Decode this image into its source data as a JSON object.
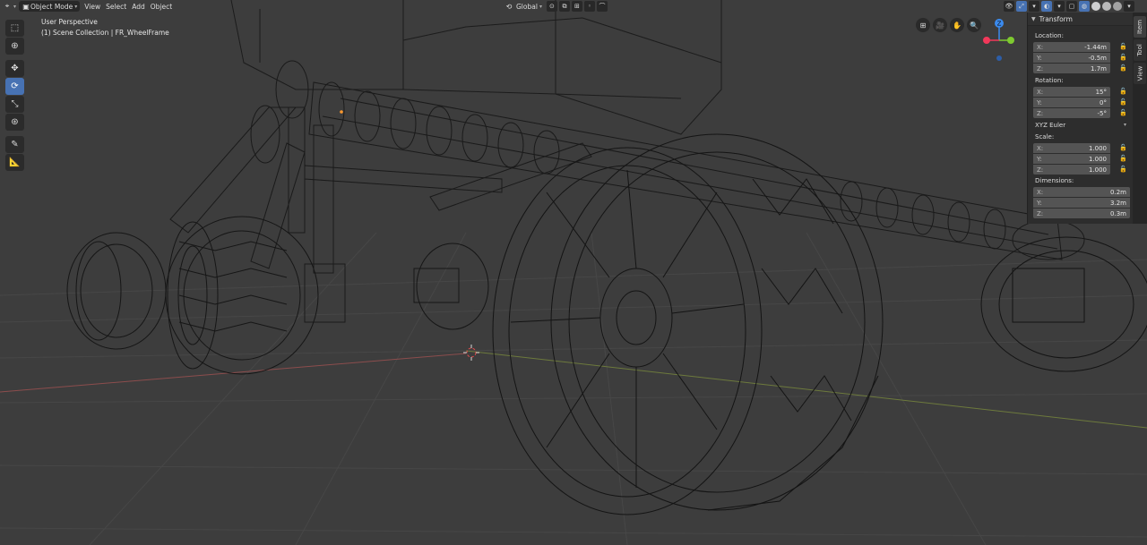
{
  "header": {
    "mode": "Object Mode",
    "menu": [
      "View",
      "Select",
      "Add",
      "Object"
    ],
    "transform_orientation": "Global"
  },
  "overlay": {
    "perspective": "User Perspective",
    "collection": "(1) Scene Collection | FR_WheelFrame"
  },
  "toolbar": {
    "tools": [
      "select-box-icon",
      "cursor-icon",
      "move-icon",
      "rotate-icon",
      "scale-icon",
      "transform-icon",
      "annotate-icon",
      "measure-icon"
    ],
    "active_tool": "rotate-icon"
  },
  "gizmo": {
    "x_color": "#f2385a",
    "y_color": "#7eca30",
    "z_color": "#3b8bef",
    "z_label": "Z"
  },
  "sidebar": {
    "panel_title": "Transform",
    "location": {
      "label": "Location:",
      "x": "-1.44m",
      "y": "-0.5m",
      "z": "1.7m"
    },
    "rotation": {
      "label": "Rotation:",
      "x": "15°",
      "y": "0°",
      "z": "-5°"
    },
    "rotation_mode": "XYZ Euler",
    "scale": {
      "label": "Scale:",
      "x": "1.000",
      "y": "1.000",
      "z": "1.000"
    },
    "dimensions": {
      "label": "Dimensions:",
      "x": "0.2m",
      "y": "3.2m",
      "z": "0.3m"
    },
    "axis_labels": {
      "x": "X:",
      "y": "Y:",
      "z": "Z:"
    },
    "tabs": [
      "Item",
      "Tool",
      "View"
    ]
  },
  "colors": {
    "accent": "#4772b3",
    "background": "#3d3d3d",
    "wire": "#000000"
  }
}
